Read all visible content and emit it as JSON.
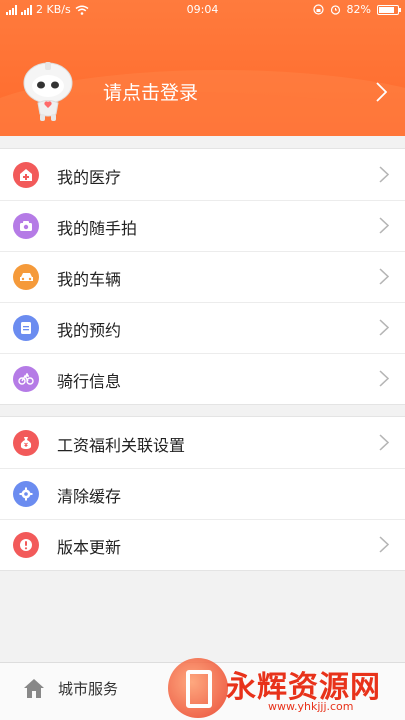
{
  "status_bar": {
    "network": "2 KB/s",
    "time": "09:04",
    "battery": "82%",
    "battery_level": 0.82
  },
  "profile": {
    "login_prompt": "请点击登录"
  },
  "group1": [
    {
      "label": "我的医疗",
      "icon": "medical-icon",
      "color": "#f25a5a",
      "chevron": true
    },
    {
      "label": "我的随手拍",
      "icon": "camera-icon",
      "color": "#b57be6",
      "chevron": true
    },
    {
      "label": "我的车辆",
      "icon": "car-icon",
      "color": "#f59a3a",
      "chevron": true
    },
    {
      "label": "我的预约",
      "icon": "document-icon",
      "color": "#6b8cf0",
      "chevron": true
    },
    {
      "label": "骑行信息",
      "icon": "bicycle-icon",
      "color": "#b57be6",
      "chevron": true
    }
  ],
  "group2": [
    {
      "label": "工资福利关联设置",
      "icon": "money-bag-icon",
      "color": "#f25a5a",
      "chevron": true
    },
    {
      "label": "清除缓存",
      "icon": "gear-icon",
      "color": "#6b8cf0",
      "chevron": false
    },
    {
      "label": "版本更新",
      "icon": "alert-icon",
      "color": "#f25a5a",
      "chevron": true
    }
  ],
  "tabbar": {
    "home_label": "城市服务"
  },
  "watermark": {
    "title": "永辉资源网",
    "url": "www.yhkjjj.com"
  }
}
